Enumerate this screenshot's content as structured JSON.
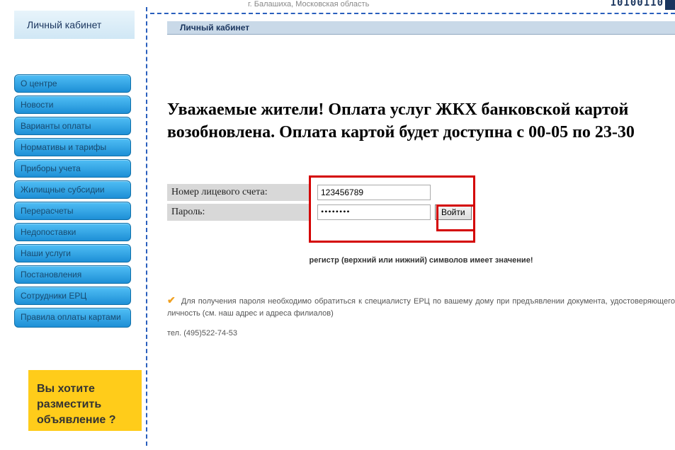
{
  "header": {
    "location": "г. Балашиха, Московская область",
    "barcode": "10100110"
  },
  "sidebar": {
    "personal_tab": "Личный кабинет",
    "nav": [
      "О центре",
      "Новости",
      "Варианты оплаты",
      "Нормативы и тарифы",
      "Приборы учета",
      "Жилищные субсидии",
      "Перерасчеты",
      "Недопоставки",
      "Наши услуги",
      "Постановления",
      "Сотрудники ЕРЦ",
      "Правила оплаты картами"
    ],
    "ad": {
      "line1": "Вы хотите",
      "line2": "разместить",
      "line3": "объявление ?"
    }
  },
  "main": {
    "section_title": "Личный кабинет",
    "announcement": "Уважаемые жители! Оплата услуг ЖКХ банковской картой возобновлена. Оплата картой будет доступна с 00-05 по 23-30",
    "form": {
      "account_label": "Номер лицевого счета:",
      "account_value": "123456789",
      "password_label": "Пароль:",
      "password_value": "••••••••",
      "submit": "Войти"
    },
    "hint": "регистр (верхний или нижний) символов имеет значение!",
    "info": "Для получения пароля необходимо обратиться к специалисту ЕРЦ по вашему дому при предъявлении документа, удостоверяющего личность (см. наш адрес и адреса филиалов)",
    "phone": "тел. (495)522-74-53"
  }
}
